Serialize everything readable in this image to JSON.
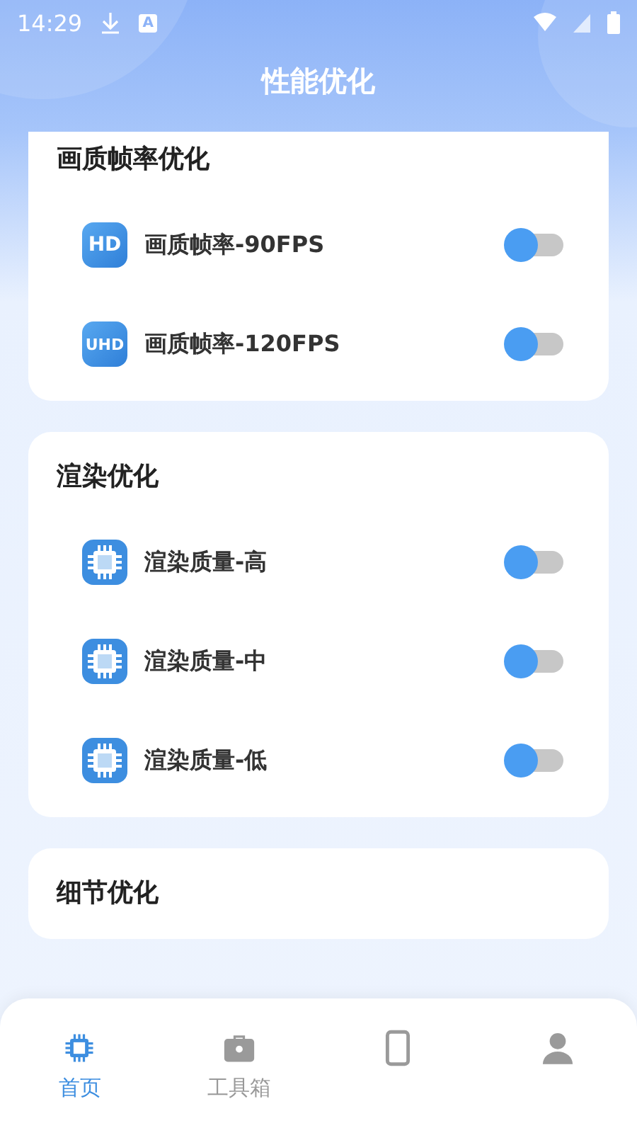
{
  "status_bar": {
    "time": "14:29",
    "notification_badge": "A"
  },
  "header": {
    "title": "性能优化"
  },
  "sections": [
    {
      "title": "画质帧率优化",
      "items": [
        {
          "kind": "badge",
          "badge": "HD",
          "label": "画质帧率-90FPS",
          "on": false
        },
        {
          "kind": "badge",
          "badge": "UHD",
          "label": "画质帧率-120FPS",
          "on": false
        }
      ]
    },
    {
      "title": "渲染优化",
      "items": [
        {
          "kind": "chip",
          "label": "渲染质量-高",
          "on": false
        },
        {
          "kind": "chip",
          "label": "渲染质量-中",
          "on": false
        },
        {
          "kind": "chip",
          "label": "渲染质量-低",
          "on": false
        }
      ]
    },
    {
      "title": "细节优化"
    }
  ],
  "bottom_nav": [
    {
      "kind": "chip",
      "label": "首页",
      "selected": true
    },
    {
      "kind": "toolbox",
      "label": "工具箱",
      "selected": false
    },
    {
      "kind": "phone",
      "selected": false
    },
    {
      "kind": "person",
      "selected": false
    }
  ]
}
